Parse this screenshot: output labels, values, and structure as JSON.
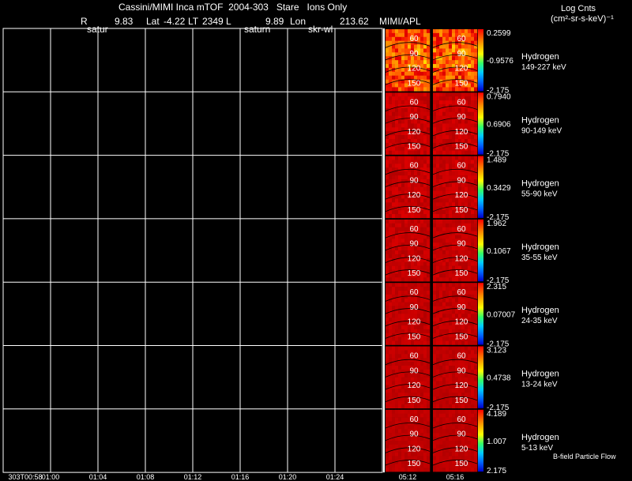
{
  "header": {
    "title": "Cassini/MIMI Inca mTOF  2004-303   Stare   Ions Only",
    "r_label": "R",
    "r_value": "9.83",
    "lat_label": "Lat",
    "lat_value": "-4.22",
    "lt_label": "LT",
    "lt_value": "2349",
    "l_label": "L",
    "l_value": "9.89",
    "lon_label": "Lon",
    "lon_value": "213.62",
    "org": "MIMI/APL",
    "targets": [
      "satur",
      "saturn",
      "skr-wl"
    ],
    "units_line1": "Log Cnts",
    "units_line2": "(cm²-sr-s-keV)⁻¹"
  },
  "footer": {
    "flow_label": "B-field Particle Flow"
  },
  "colors": {
    "background": "#000000",
    "grid": "#ffffff",
    "map_low": "#aa0000",
    "map_high": "#ffdd00"
  },
  "chart_data": {
    "type": "heatmap",
    "x_ticks": [
      "303T00:58",
      "01:00",
      "01:04",
      "01:08",
      "01:12",
      "01:16",
      "01:20",
      "01:24"
    ],
    "snapshot_times": [
      "05:12",
      "05:16"
    ],
    "pitch_angle_ticks": [
      "60",
      "90",
      "120",
      "150"
    ],
    "species": "Hydrogen",
    "panels": [
      {
        "species": "Hydrogen",
        "energy": "149-227 keV",
        "cbar_max": "0.2599",
        "cbar_mid": "-0.9576",
        "cbar_min": "-2.175"
      },
      {
        "species": "Hydrogen",
        "energy": "90-149 keV",
        "cbar_max": "0.7940",
        "cbar_mid": "0.6906",
        "cbar_min": "-2.175"
      },
      {
        "species": "Hydrogen",
        "energy": "55-90 keV",
        "cbar_max": "1.489",
        "cbar_mid": "0.3429",
        "cbar_min": "-2.175"
      },
      {
        "species": "Hydrogen",
        "energy": "35-55 keV",
        "cbar_max": "1.962",
        "cbar_mid": "0.1067",
        "cbar_min": "-2.175"
      },
      {
        "species": "Hydrogen",
        "energy": "24-35 keV",
        "cbar_max": "2.315",
        "cbar_mid": "0.07007",
        "cbar_min": "-2.175"
      },
      {
        "species": "Hydrogen",
        "energy": "13-24 keV",
        "cbar_max": "3.123",
        "cbar_mid": "0.4738",
        "cbar_min": "-2.175"
      },
      {
        "species": "Hydrogen",
        "energy": "5-13 keV",
        "cbar_max": "4.189",
        "cbar_mid": "1.007",
        "cbar_min": "2.175"
      }
    ]
  }
}
